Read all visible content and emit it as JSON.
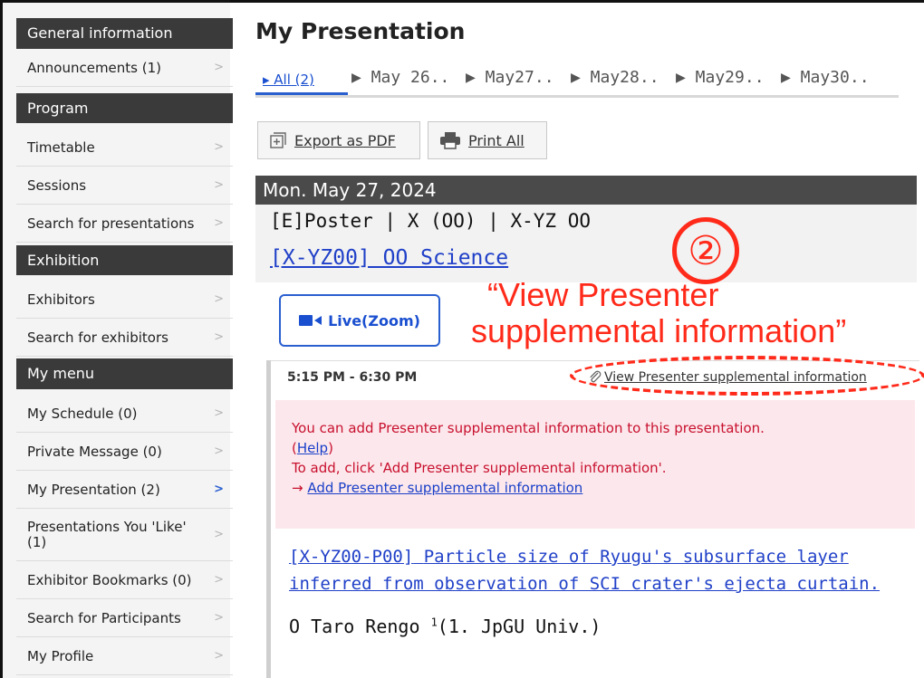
{
  "sidebar": {
    "items": [
      {
        "label": "General information",
        "type": "header"
      },
      {
        "label": "Announcements (1)",
        "type": "link"
      },
      {
        "label": "Program",
        "type": "header"
      },
      {
        "label": "Timetable",
        "type": "link"
      },
      {
        "label": "Sessions",
        "type": "link"
      },
      {
        "label": "Search for presentations",
        "type": "link"
      },
      {
        "label": "Exhibition",
        "type": "header"
      },
      {
        "label": "Exhibitors",
        "type": "link"
      },
      {
        "label": "Search for exhibitors",
        "type": "link"
      },
      {
        "label": "My menu",
        "type": "header"
      },
      {
        "label": "My Schedule (0)",
        "type": "link"
      },
      {
        "label": "Private Message (0)",
        "type": "link"
      },
      {
        "label": "My Presentation (2)",
        "type": "link",
        "active": true
      },
      {
        "label_line1": "Presentations You 'Like'",
        "label_line2": "(1)",
        "type": "link"
      },
      {
        "label": "Exhibitor Bookmarks (0)",
        "type": "link"
      },
      {
        "label": "Search for Participants",
        "type": "link"
      },
      {
        "label": "My Profile",
        "type": "link"
      }
    ],
    "chevron": ">",
    "colors": {
      "header_bg": "#3a3a3a",
      "active_chevron": "#2a5fd0"
    }
  },
  "main": {
    "title": "My Presentation",
    "tabs": [
      "▸ All (2)",
      "▶ May 26..",
      "▶ May27..",
      "▶ May28..",
      "▶ May29..",
      "▶ May30.."
    ],
    "buttons": {
      "export_pdf": "Export as PDF",
      "print_all": "Print All"
    },
    "date": "Mon. May 27, 2024",
    "session_type": "[E]Poster | X (OO)  | X-YZ OO",
    "session_title": "[X-YZ00] OO Science",
    "live_button": "Live(Zoom)",
    "time_range": "5:15 PM - 6:30 PM",
    "view_supplemental": "View Presenter supplemental information",
    "notice": {
      "line1": "You can add Presenter supplemental information to this presentation.",
      "help_open": "(",
      "help": "Help",
      "help_close": ")",
      "line3": "To add, click 'Add Presenter supplemental information'.",
      "arrow": "→",
      "add_link": "Add Presenter supplemental information"
    },
    "presentation_code": "[X-YZ00-P00]",
    "presentation_title": "Particle size of Ryugu's subsurface layer inferred from observation of SCI crater's ejecta curtain.",
    "author_marker": "O",
    "author_name": "Taro Rengo",
    "author_sup": "1",
    "author_affil": "(1. JpGU Univ.)"
  },
  "annotation": {
    "number": "②",
    "text_line1": "“View Presenter",
    "text_line2": "supplemental information”",
    "color": "#ff2a1a"
  }
}
